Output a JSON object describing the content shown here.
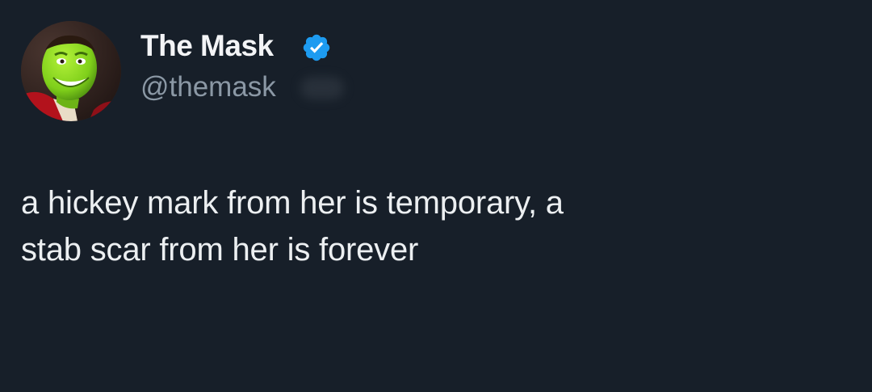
{
  "user": {
    "display_name": "The Mask",
    "handle": "@themask",
    "verified_icon": "verified-badge-icon",
    "avatar_icon": "green-mask-face-avatar"
  },
  "tweet": {
    "line1": "a hickey mark from her is temporary, a",
    "line2": "stab scar from her is forever"
  },
  "colors": {
    "background": "#171f29",
    "text": "#eceff1",
    "handle": "#8b98a5",
    "verified": "#1d9bf0"
  }
}
